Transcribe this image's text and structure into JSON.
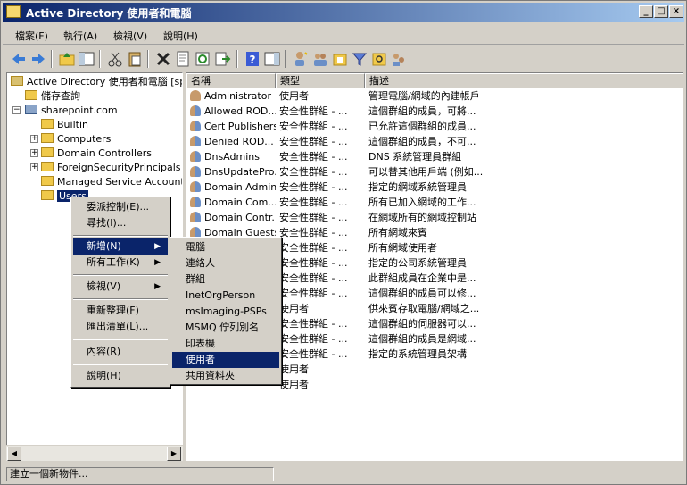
{
  "window": {
    "title": "Active Directory 使用者和電腦",
    "buttons": {
      "minimize": "_",
      "maximize": "□",
      "close": "×"
    }
  },
  "menubar": [
    "檔案(F)",
    "執行(A)",
    "檢視(V)",
    "說明(H)"
  ],
  "tree": {
    "root": "Active Directory 使用者和電腦 [sp",
    "saved_queries": "儲存查詢",
    "domain": "sharepoint.com",
    "children": [
      "Builtin",
      "Computers",
      "Domain Controllers",
      "ForeignSecurityPrincipals",
      "Managed Service Accounts",
      "Users"
    ]
  },
  "list": {
    "columns": [
      "名稱",
      "類型",
      "描述"
    ],
    "rows": [
      {
        "name": "Administrator",
        "type": "使用者",
        "desc": "管理電腦/網域的內建帳戶",
        "icon": "single"
      },
      {
        "name": "Allowed ROD...",
        "type": "安全性群組 - ...",
        "desc": "這個群組的成員，可將...",
        "icon": "group"
      },
      {
        "name": "Cert Publishers",
        "type": "安全性群組 - ...",
        "desc": "已允許這個群組的成員...",
        "icon": "group"
      },
      {
        "name": "Denied ROD...",
        "type": "安全性群組 - ...",
        "desc": "這個群組的成員，不可...",
        "icon": "group"
      },
      {
        "name": "DnsAdmins",
        "type": "安全性群組 - ...",
        "desc": "DNS 系統管理員群組",
        "icon": "group"
      },
      {
        "name": "DnsUpdatePro...",
        "type": "安全性群組 - ...",
        "desc": "可以替其他用戶端 (例如...",
        "icon": "group"
      },
      {
        "name": "Domain Admins",
        "type": "安全性群組 - ...",
        "desc": "指定的網域系統管理員",
        "icon": "group"
      },
      {
        "name": "Domain Com...",
        "type": "安全性群組 - ...",
        "desc": "所有已加入網域的工作...",
        "icon": "group"
      },
      {
        "name": "Domain Contr...",
        "type": "安全性群組 - ...",
        "desc": "在網域所有的網域控制站",
        "icon": "group"
      },
      {
        "name": "Domain Guests",
        "type": "安全性群組 - ...",
        "desc": "所有網域來賓",
        "icon": "group"
      },
      {
        "name": "",
        "type": "安全性群組 - ...",
        "desc": "所有網域使用者",
        "icon": ""
      },
      {
        "name": "",
        "type": "安全性群組 - ...",
        "desc": "指定的公司系統管理員",
        "icon": ""
      },
      {
        "name": "",
        "type": "安全性群組 - ...",
        "desc": "此群組成員在企業中是...",
        "icon": ""
      },
      {
        "name": "",
        "type": "安全性群組 - ...",
        "desc": "這個群組的成員可以修...",
        "icon": ""
      },
      {
        "name": "",
        "type": "使用者",
        "desc": "供來賓存取電腦/網域之...",
        "icon": ""
      },
      {
        "name": "",
        "type": "安全性群組 - ...",
        "desc": "這個群組的伺服器可以...",
        "icon": ""
      },
      {
        "name": "",
        "type": "安全性群組 - ...",
        "desc": "這個群組的成員是網域...",
        "icon": ""
      },
      {
        "name": "",
        "type": "安全性群組 - ...",
        "desc": "指定的系統管理員架構",
        "icon": ""
      },
      {
        "name": "",
        "type": "使用者",
        "desc": "",
        "icon": ""
      },
      {
        "name": "",
        "type": "使用者",
        "desc": "",
        "icon": ""
      }
    ]
  },
  "context_menu": {
    "items": [
      "委派控制(E)...",
      "尋找(I)...",
      "新增(N)",
      "所有工作(K)",
      "檢視(V)",
      "重新整理(F)",
      "匯出清單(L)...",
      "內容(R)",
      "說明(H)"
    ]
  },
  "submenu": {
    "items": [
      "電腦",
      "連絡人",
      "群組",
      "InetOrgPerson",
      "msImaging-PSPs",
      "MSMQ 佇列別名",
      "印表機",
      "使用者",
      "共用資料夾"
    ],
    "highlighted": 7
  },
  "status": "建立一個新物件..."
}
